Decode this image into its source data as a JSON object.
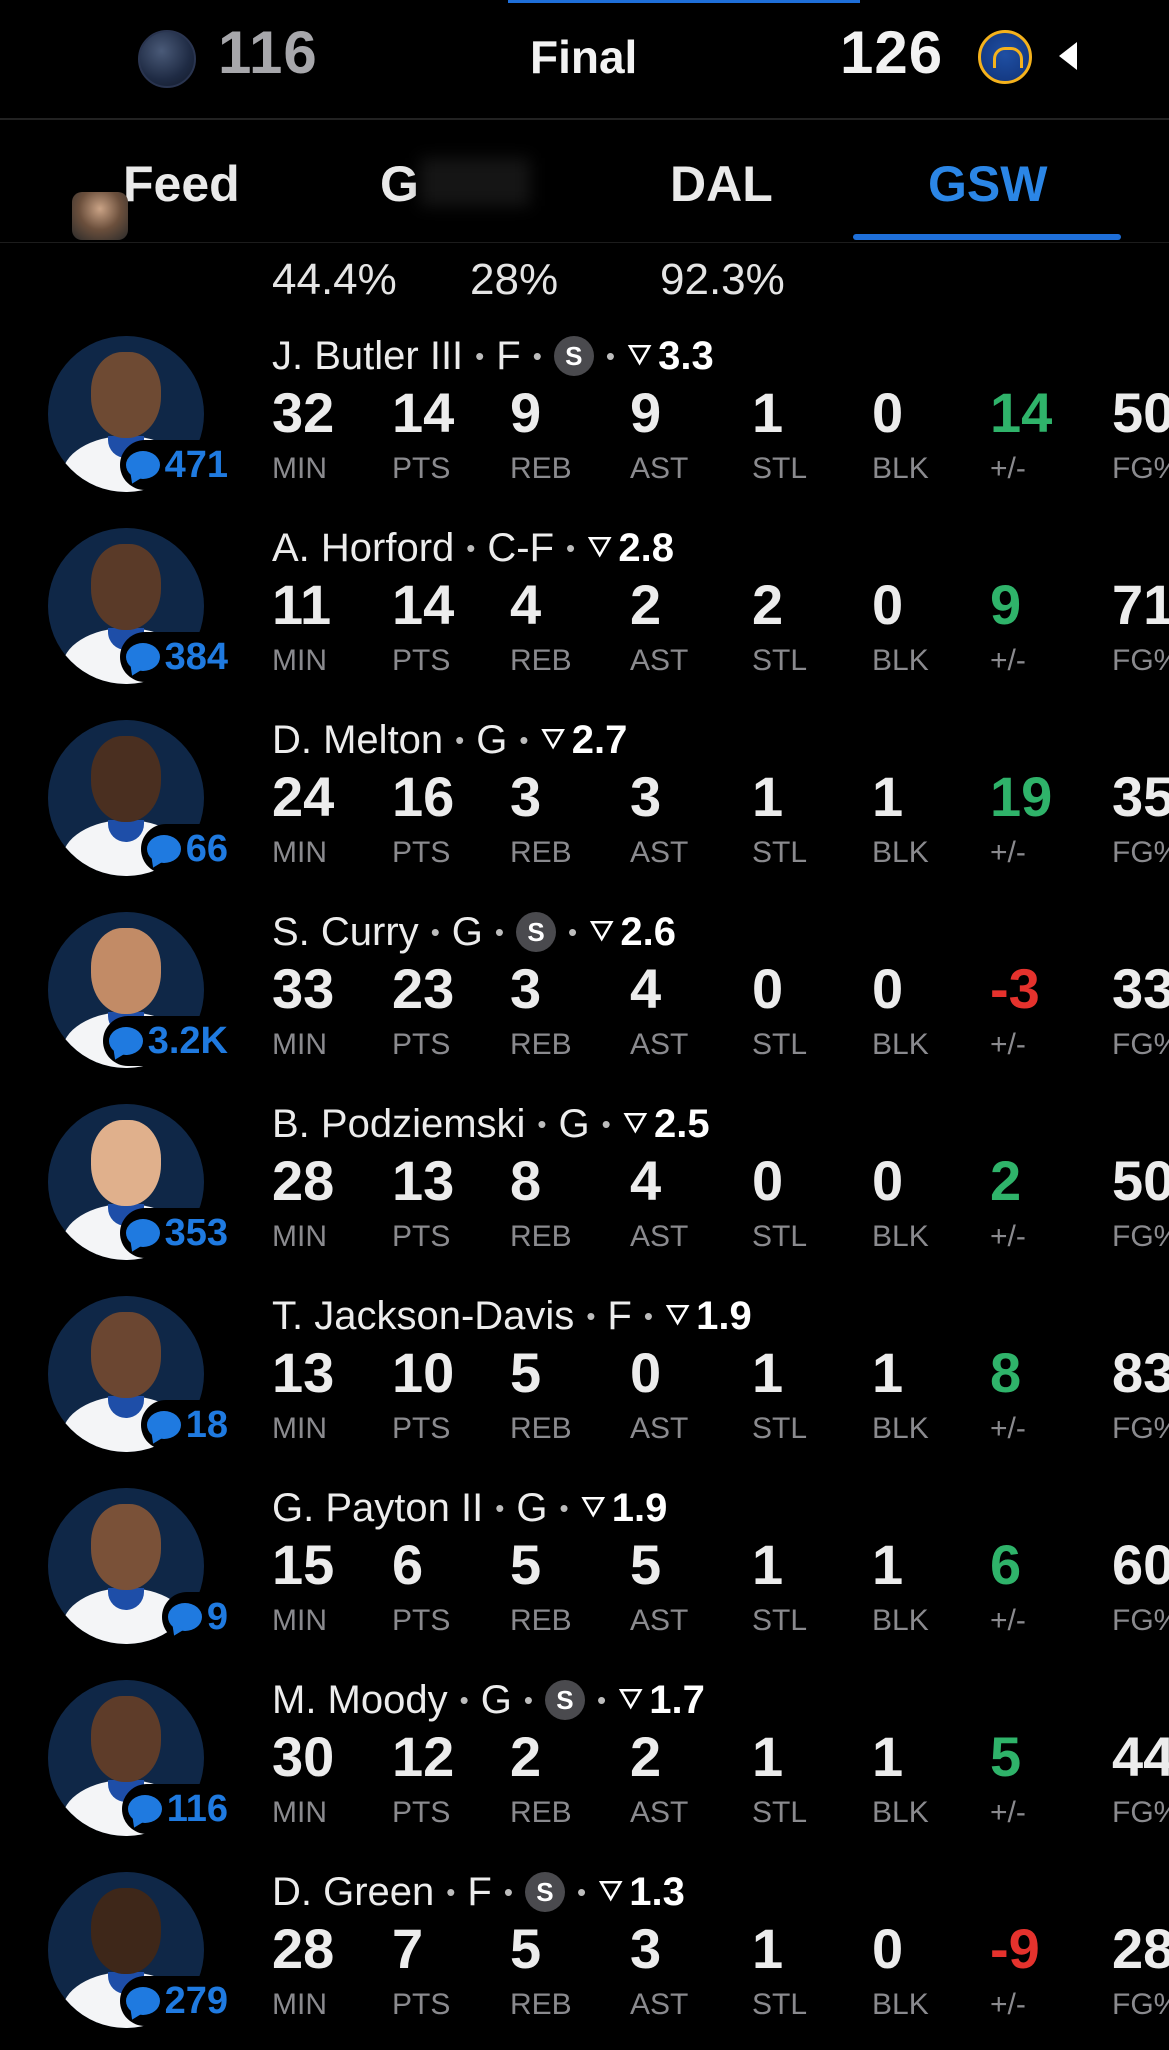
{
  "header": {
    "away_score": "116",
    "home_score": "126",
    "status": "Final",
    "away_logo_icon": "mavericks-logo-icon",
    "home_logo_icon": "warriors-logo-icon",
    "back_icon": "chevron-left-icon"
  },
  "tabs": {
    "items": [
      {
        "label": "Feed"
      },
      {
        "label": "G"
      },
      {
        "label": "DAL"
      },
      {
        "label": "GSW",
        "active": true
      }
    ],
    "accent": "#1e6fd9"
  },
  "team_summary": {
    "values": [
      "44.4%",
      "28%",
      "92.3%"
    ]
  },
  "stat_labels": {
    "min": "MIN",
    "pts": "PTS",
    "reb": "REB",
    "ast": "AST",
    "stl": "STL",
    "blk": "BLK",
    "pm": "+/-",
    "fg": "FG%"
  },
  "players": [
    {
      "name": "J. Butler III",
      "pos": "F",
      "starter": true,
      "starter_mark": "S",
      "rating": "3.3",
      "comments": "471",
      "min": "32",
      "pts": "14",
      "reb": "9",
      "ast": "9",
      "stl": "1",
      "blk": "0",
      "pm": "14",
      "pm_sign": "pos",
      "fg": "50"
    },
    {
      "name": "A. Horford",
      "pos": "C-F",
      "starter": false,
      "rating": "2.8",
      "comments": "384",
      "min": "11",
      "pts": "14",
      "reb": "4",
      "ast": "2",
      "stl": "2",
      "blk": "0",
      "pm": "9",
      "pm_sign": "pos",
      "fg": "71"
    },
    {
      "name": "D. Melton",
      "pos": "G",
      "starter": false,
      "rating": "2.7",
      "comments": "66",
      "min": "24",
      "pts": "16",
      "reb": "3",
      "ast": "3",
      "stl": "1",
      "blk": "1",
      "pm": "19",
      "pm_sign": "pos",
      "fg": "35"
    },
    {
      "name": "S. Curry",
      "pos": "G",
      "starter": true,
      "starter_mark": "S",
      "rating": "2.6",
      "comments": "3.2K",
      "min": "33",
      "pts": "23",
      "reb": "3",
      "ast": "4",
      "stl": "0",
      "blk": "0",
      "pm": "-3",
      "pm_sign": "neg",
      "fg": "33"
    },
    {
      "name": "B. Podziemski",
      "pos": "G",
      "starter": false,
      "rating": "2.5",
      "comments": "353",
      "min": "28",
      "pts": "13",
      "reb": "8",
      "ast": "4",
      "stl": "0",
      "blk": "0",
      "pm": "2",
      "pm_sign": "pos",
      "fg": "50"
    },
    {
      "name": "T. Jackson-Davis",
      "pos": "F",
      "starter": false,
      "rating": "1.9",
      "comments": "18",
      "min": "13",
      "pts": "10",
      "reb": "5",
      "ast": "0",
      "stl": "1",
      "blk": "1",
      "pm": "8",
      "pm_sign": "pos",
      "fg": "83"
    },
    {
      "name": "G. Payton II",
      "pos": "G",
      "starter": false,
      "rating": "1.9",
      "comments": "9",
      "min": "15",
      "pts": "6",
      "reb": "5",
      "ast": "5",
      "stl": "1",
      "blk": "1",
      "pm": "6",
      "pm_sign": "pos",
      "fg": "60"
    },
    {
      "name": "M. Moody",
      "pos": "G",
      "starter": true,
      "starter_mark": "S",
      "rating": "1.7",
      "comments": "116",
      "min": "30",
      "pts": "12",
      "reb": "2",
      "ast": "2",
      "stl": "1",
      "blk": "1",
      "pm": "5",
      "pm_sign": "pos",
      "fg": "44"
    },
    {
      "name": "D. Green",
      "pos": "F",
      "starter": true,
      "starter_mark": "S",
      "rating": "1.3",
      "comments": "279",
      "min": "28",
      "pts": "7",
      "reb": "5",
      "ast": "3",
      "stl": "1",
      "blk": "0",
      "pm": "-9",
      "pm_sign": "neg",
      "fg": "28"
    }
  ],
  "colors": {
    "positive": "#2fb36a",
    "negative": "#e5322d",
    "comment_blue": "#1f7ae0",
    "active_tab": "#2b86e6"
  }
}
